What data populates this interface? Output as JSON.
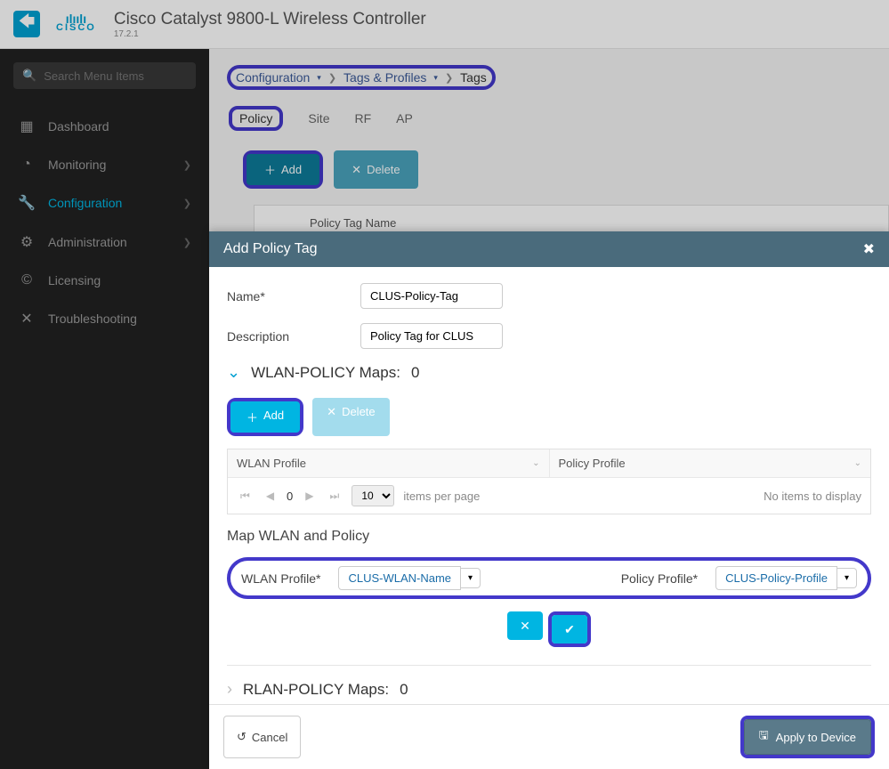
{
  "header": {
    "title": "Cisco Catalyst 9800-L Wireless Controller",
    "version": "17.2.1",
    "logo_text": "CISCO"
  },
  "search": {
    "placeholder": "Search Menu Items"
  },
  "nav": [
    {
      "label": "Dashboard",
      "icon": "▦",
      "expand": false,
      "active": false
    },
    {
      "label": "Monitoring",
      "icon": "◔",
      "expand": true,
      "active": false
    },
    {
      "label": "Configuration",
      "icon": "🔧",
      "expand": true,
      "active": true
    },
    {
      "label": "Administration",
      "icon": "⚙",
      "expand": true,
      "active": false
    },
    {
      "label": "Licensing",
      "icon": "©",
      "expand": false,
      "active": false
    },
    {
      "label": "Troubleshooting",
      "icon": "✕",
      "expand": false,
      "active": false
    }
  ],
  "breadcrumb": {
    "parts": [
      "Configuration",
      "Tags & Profiles"
    ],
    "current": "Tags"
  },
  "tabs": [
    "Policy",
    "Site",
    "RF",
    "AP"
  ],
  "active_tab": "Policy",
  "actions": {
    "add": "Add",
    "delete": "Delete"
  },
  "grid": {
    "col1": "Policy Tag Name"
  },
  "modal": {
    "title": "Add Policy Tag",
    "close": "✖",
    "name_label": "Name*",
    "name_value": "CLUS-Policy-Tag",
    "desc_label": "Description",
    "desc_value": "Policy Tag for CLUS",
    "wlan_section": "WLAN-POLICY Maps:",
    "wlan_count": "0",
    "map_add": "Add",
    "map_delete": "Delete",
    "col_wlan": "WLAN Profile",
    "col_policy": "Policy Profile",
    "page_current": "0",
    "page_size": "10",
    "page_size_label": "items per page",
    "empty_msg": "No items to display",
    "map_title": "Map WLAN and Policy",
    "wlan_profile_label": "WLAN Profile*",
    "wlan_profile_value": "CLUS-WLAN-Name",
    "policy_profile_label": "Policy Profile*",
    "policy_profile_value": "CLUS-Policy-Profile",
    "rlan_section": "RLAN-POLICY Maps:",
    "rlan_count": "0",
    "cancel": "Cancel",
    "apply": "Apply to Device"
  }
}
